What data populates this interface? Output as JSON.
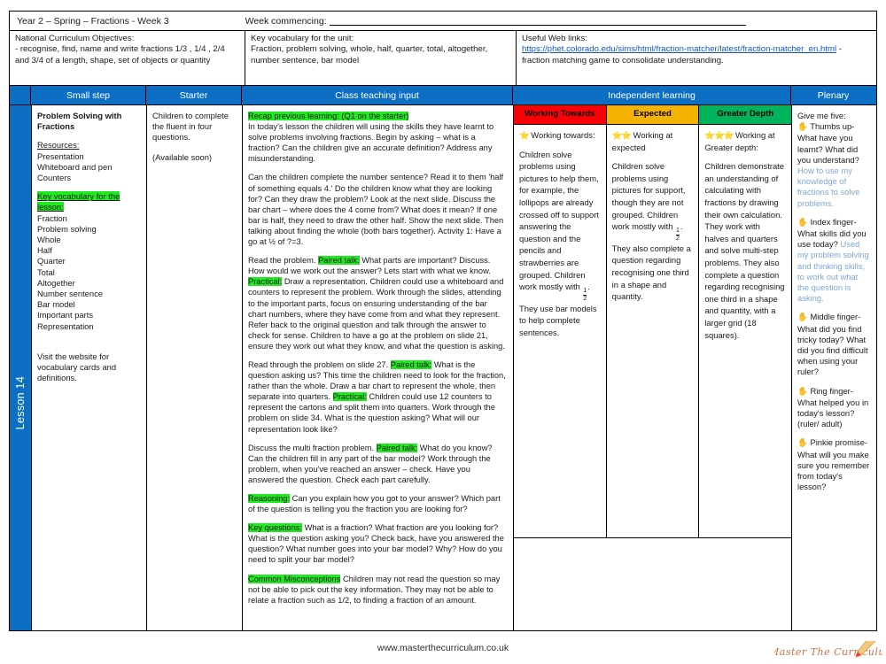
{
  "header": {
    "title": "Year 2 – Spring – Fractions - Week 3",
    "week_commencing_label": "Week commencing:",
    "nc_title": "National Curriculum Objectives:",
    "nc_body": "- recognise, find, name and write fractions 1/3 , 1/4 , 2/4 and 3/4 of a length, shape, set of objects or quantity",
    "vocab_title": "Key vocabulary for the unit:",
    "vocab_body": "Fraction, problem solving, whole, half, quarter, total, altogether, number sentence, bar model",
    "web_title": "Useful Web links:",
    "web_url": "https://phet.colorado.edu/sims/html/fraction-matcher/latest/fraction-matcher_en.html",
    "web_suffix": "- fraction matching game to consolidate understanding."
  },
  "columns": {
    "spine": "Lesson 14",
    "small_step": "Small step",
    "starter": "Starter",
    "class_input": "Class teaching input",
    "independent": "Independent learning",
    "plenary": "Plenary"
  },
  "small_step": {
    "heading": "Problem Solving with Fractions",
    "resources_label": "Resources:",
    "resources": [
      "Presentation",
      "Whiteboard and pen",
      "Counters"
    ],
    "vocab_label": "Key vocabulary for the lesson:",
    "vocab": [
      "Fraction",
      "Problem solving",
      "Whole",
      "Half",
      "Quarter",
      "Total",
      "Altogether",
      "Number sentence",
      "Bar model",
      "Important parts",
      "Representation"
    ],
    "footnote": "Visit the website for vocabulary cards and definitions."
  },
  "starter": {
    "text": "Children to complete the fluent in four questions.",
    "note": "(Available soon)"
  },
  "class_input": {
    "p1_label": "Recap previous learning: (Q1 on the starter)",
    "p1": "In today's lesson the children will using the skills they have learnt to solve problems involving fractions. Begin by asking – what is a fraction? Can the children give an accurate definition? Address any misunderstanding.",
    "p2": "Can the children complete the number sentence? Read it to them 'half of something equals 4.' Do the children know what they are looking for? Can they draw the problem? Look at the next slide. Discuss the bar chart – where does the 4 come from? What does it mean? If one bar is half, they need to draw the other half. Show the next slide. Then talking about finding the whole (both bars together). Activity 1: Have a go at ½ of  ?=3.",
    "p3_pre": "Read the problem.",
    "p3_label1": "Paired talk:",
    "p3_mid": "What parts are important? Discuss. How would we work out the answer? Lets start with what we know.",
    "p3_label2": "Practical:",
    "p3_post": "Draw a representation. Children could use a whiteboard and counters to represent the problem. Work through the slides, attending to the important parts, focus on ensuring understanding of the bar chart numbers, where they have come from and what they represent. Refer back to the original question and talk through the answer to check for sense. Children to have a go at the problem on slide 21, ensure they work out what they know, and what the question is asking.",
    "p4_pre": "Read through the problem on slide 27.",
    "p4_label1": "Paired talk:",
    "p4_mid": "What is the question asking us? This time the children need to look for the fraction, rather than the whole. Draw a bar chart to represent the whole, then separate into quarters.",
    "p4_label2": "Practical:",
    "p4_post": "Children could use 12 counters to represent the cartons and split them into quarters. Work through the problem on slide 34. What is the question asking? What will our representation look like?",
    "p5_pre": "Discuss the multi fraction problem.",
    "p5_label": "Paired talk:",
    "p5_post": "What do you know? Can the children fill in any part of the bar model? Work through the problem, when you've reached an answer – check. Have you answered the question. Check each part carefully.",
    "p6_label": "Reasoning:",
    "p6": "Can you explain how you got to your answer? Which part of the question is telling you the fraction you are looking for?",
    "p7_label": "Key questions:",
    "p7": "What is a fraction? What fraction are you looking for? What is the question asking you? Check back, have you answered the question? What number goes into your bar model? Why? How do you need to split your bar model?",
    "p8_label": "Common Misconceptions",
    "p8": "Children may not read the question so may not be able to pick out the key information. They may not be able to relate a fraction such as 1/2, to finding a fraction of an amount."
  },
  "independent": [
    {
      "header": "Working Towards",
      "stars": "⭐",
      "sub": "Working towards:",
      "body_a": "Children solve problems using pictures to help them, for example, the lollipops are already crossed off to support answering the question and the pencils and strawberries are grouped. Children work mostly with ",
      "body_b": ". They use bar models to help complete sentences."
    },
    {
      "header": "Expected",
      "stars": "⭐⭐",
      "sub": "Working at expected",
      "body_a": "Children solve problems using pictures for support, though they are not grouped. Children work mostly with ",
      "body_b": ". They also complete a question regarding recognising one third in a shape and quantity."
    },
    {
      "header": "Greater Depth",
      "stars": "⭐⭐⭐",
      "sub": "Working at Greater depth:",
      "body_a": "Children demonstrate an understanding of calculating with fractions by drawing their own calculation. They work with halves and quarters and solve multi-step problems. They also complete a question regarding recognising one third in a shape and quantity, with a larger grid (18 squares).",
      "body_b": ""
    }
  ],
  "fraction": {
    "num": "1",
    "den": "2"
  },
  "plenary": {
    "intro": "Give me five:",
    "items": [
      {
        "hand": "✋",
        "q": "Thumbs up- What have you learnt? What did you understand?",
        "a": "How to use my knowledge of fractions to solve problems."
      },
      {
        "hand": "✋",
        "q": "Index finger- What skills did you use today?",
        "a": "Used my problem solving and thinking skills, to work out what the question is asking."
      },
      {
        "hand": "✋",
        "q": "Middle finger- What did you find tricky today? What did you find difficult when using your ruler?",
        "a": ""
      },
      {
        "hand": "✋",
        "q": "Ring finger- What helped you in today's lesson? (ruler/ adult)",
        "a": ""
      },
      {
        "hand": "✋",
        "q": "Pinkie promise- What will you make sure you remember from today's lesson?",
        "a": ""
      }
    ]
  },
  "footer": {
    "site": "www.masterthecurriculum.co.uk",
    "logo_text": "Master The Curriculum"
  },
  "colors": {
    "blue": "#0d6fc4",
    "red": "#fb0007",
    "amber": "#f5b301",
    "green": "#00b259",
    "highlight": "#22e822",
    "link": "#1155cc",
    "answer": "#7da7d9"
  }
}
